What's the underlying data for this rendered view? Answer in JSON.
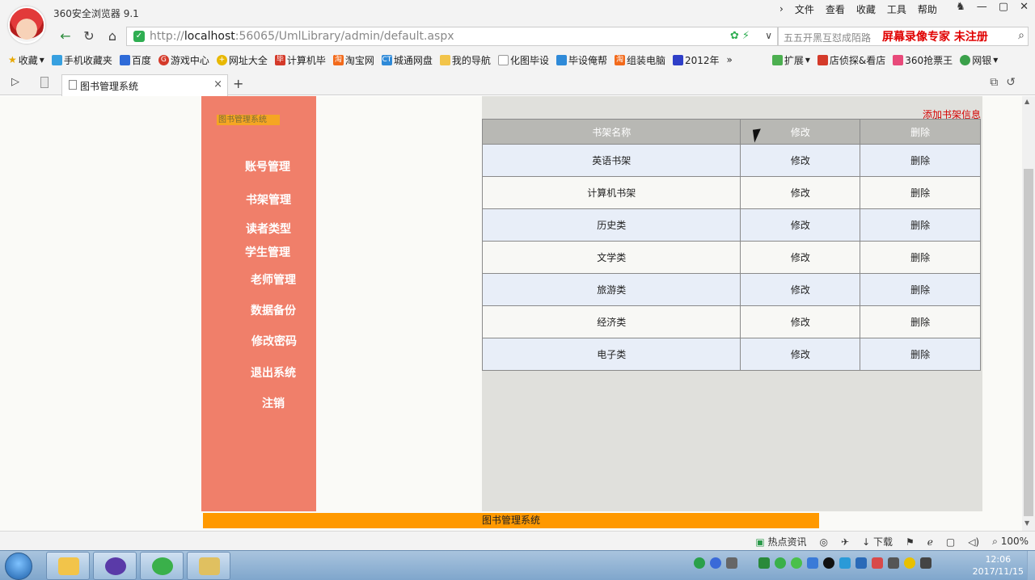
{
  "browser": {
    "app_title": "360安全浏览器 9.1",
    "menu": [
      "文件",
      "查看",
      "收藏",
      "工具",
      "帮助"
    ],
    "url_prefix": "http://",
    "url_host": "localhost",
    "url_rest": ":56065/UmlLibrary/admin/default.aspx",
    "search_hint": "五五开黑互怼成陌路",
    "recorder_brand": "屏幕录像专家  未注册",
    "bookmarks": [
      "收藏",
      "手机收藏夹",
      "百度",
      "游戏中心",
      "网址大全",
      "计算机毕",
      "淘宝网",
      "城通网盘",
      "我的导航",
      "化图毕设",
      "毕设俺帮",
      "组装电脑",
      "2012年",
      "扩展",
      "店侦探&看店",
      "360抢票王",
      "网银"
    ],
    "tab_label": "图书管理系统",
    "status": {
      "hot_news": "热点资讯",
      "download": "下载",
      "zoom": "100%"
    }
  },
  "sidebar": {
    "logo_text": "图书管理系统",
    "items": [
      "账号管理",
      "书架管理",
      "读者类型",
      "学生管理",
      "老师管理",
      "数据备份",
      "修改密码",
      "退出系统",
      "注销"
    ]
  },
  "main": {
    "add_link": "添加书架信息",
    "headers": [
      "书架名称",
      "修改",
      "删除"
    ],
    "rows": [
      {
        "name": "英语书架",
        "edit": "修改",
        "delete": "删除"
      },
      {
        "name": "计算机书架",
        "edit": "修改",
        "delete": "删除"
      },
      {
        "name": "历史类",
        "edit": "修改",
        "delete": "删除"
      },
      {
        "name": "文学类",
        "edit": "修改",
        "delete": "删除"
      },
      {
        "name": "旅游类",
        "edit": "修改",
        "delete": "删除"
      },
      {
        "name": "经济类",
        "edit": "修改",
        "delete": "删除"
      },
      {
        "name": "电子类",
        "edit": "修改",
        "delete": "删除"
      }
    ]
  },
  "footer": {
    "text": "图书管理系统"
  },
  "taskbar": {
    "time": "12:06",
    "date": "2017/11/15"
  },
  "colors": {
    "sidebar": "#f07f6a",
    "footer": "#ff9900",
    "link": "#d40000"
  }
}
